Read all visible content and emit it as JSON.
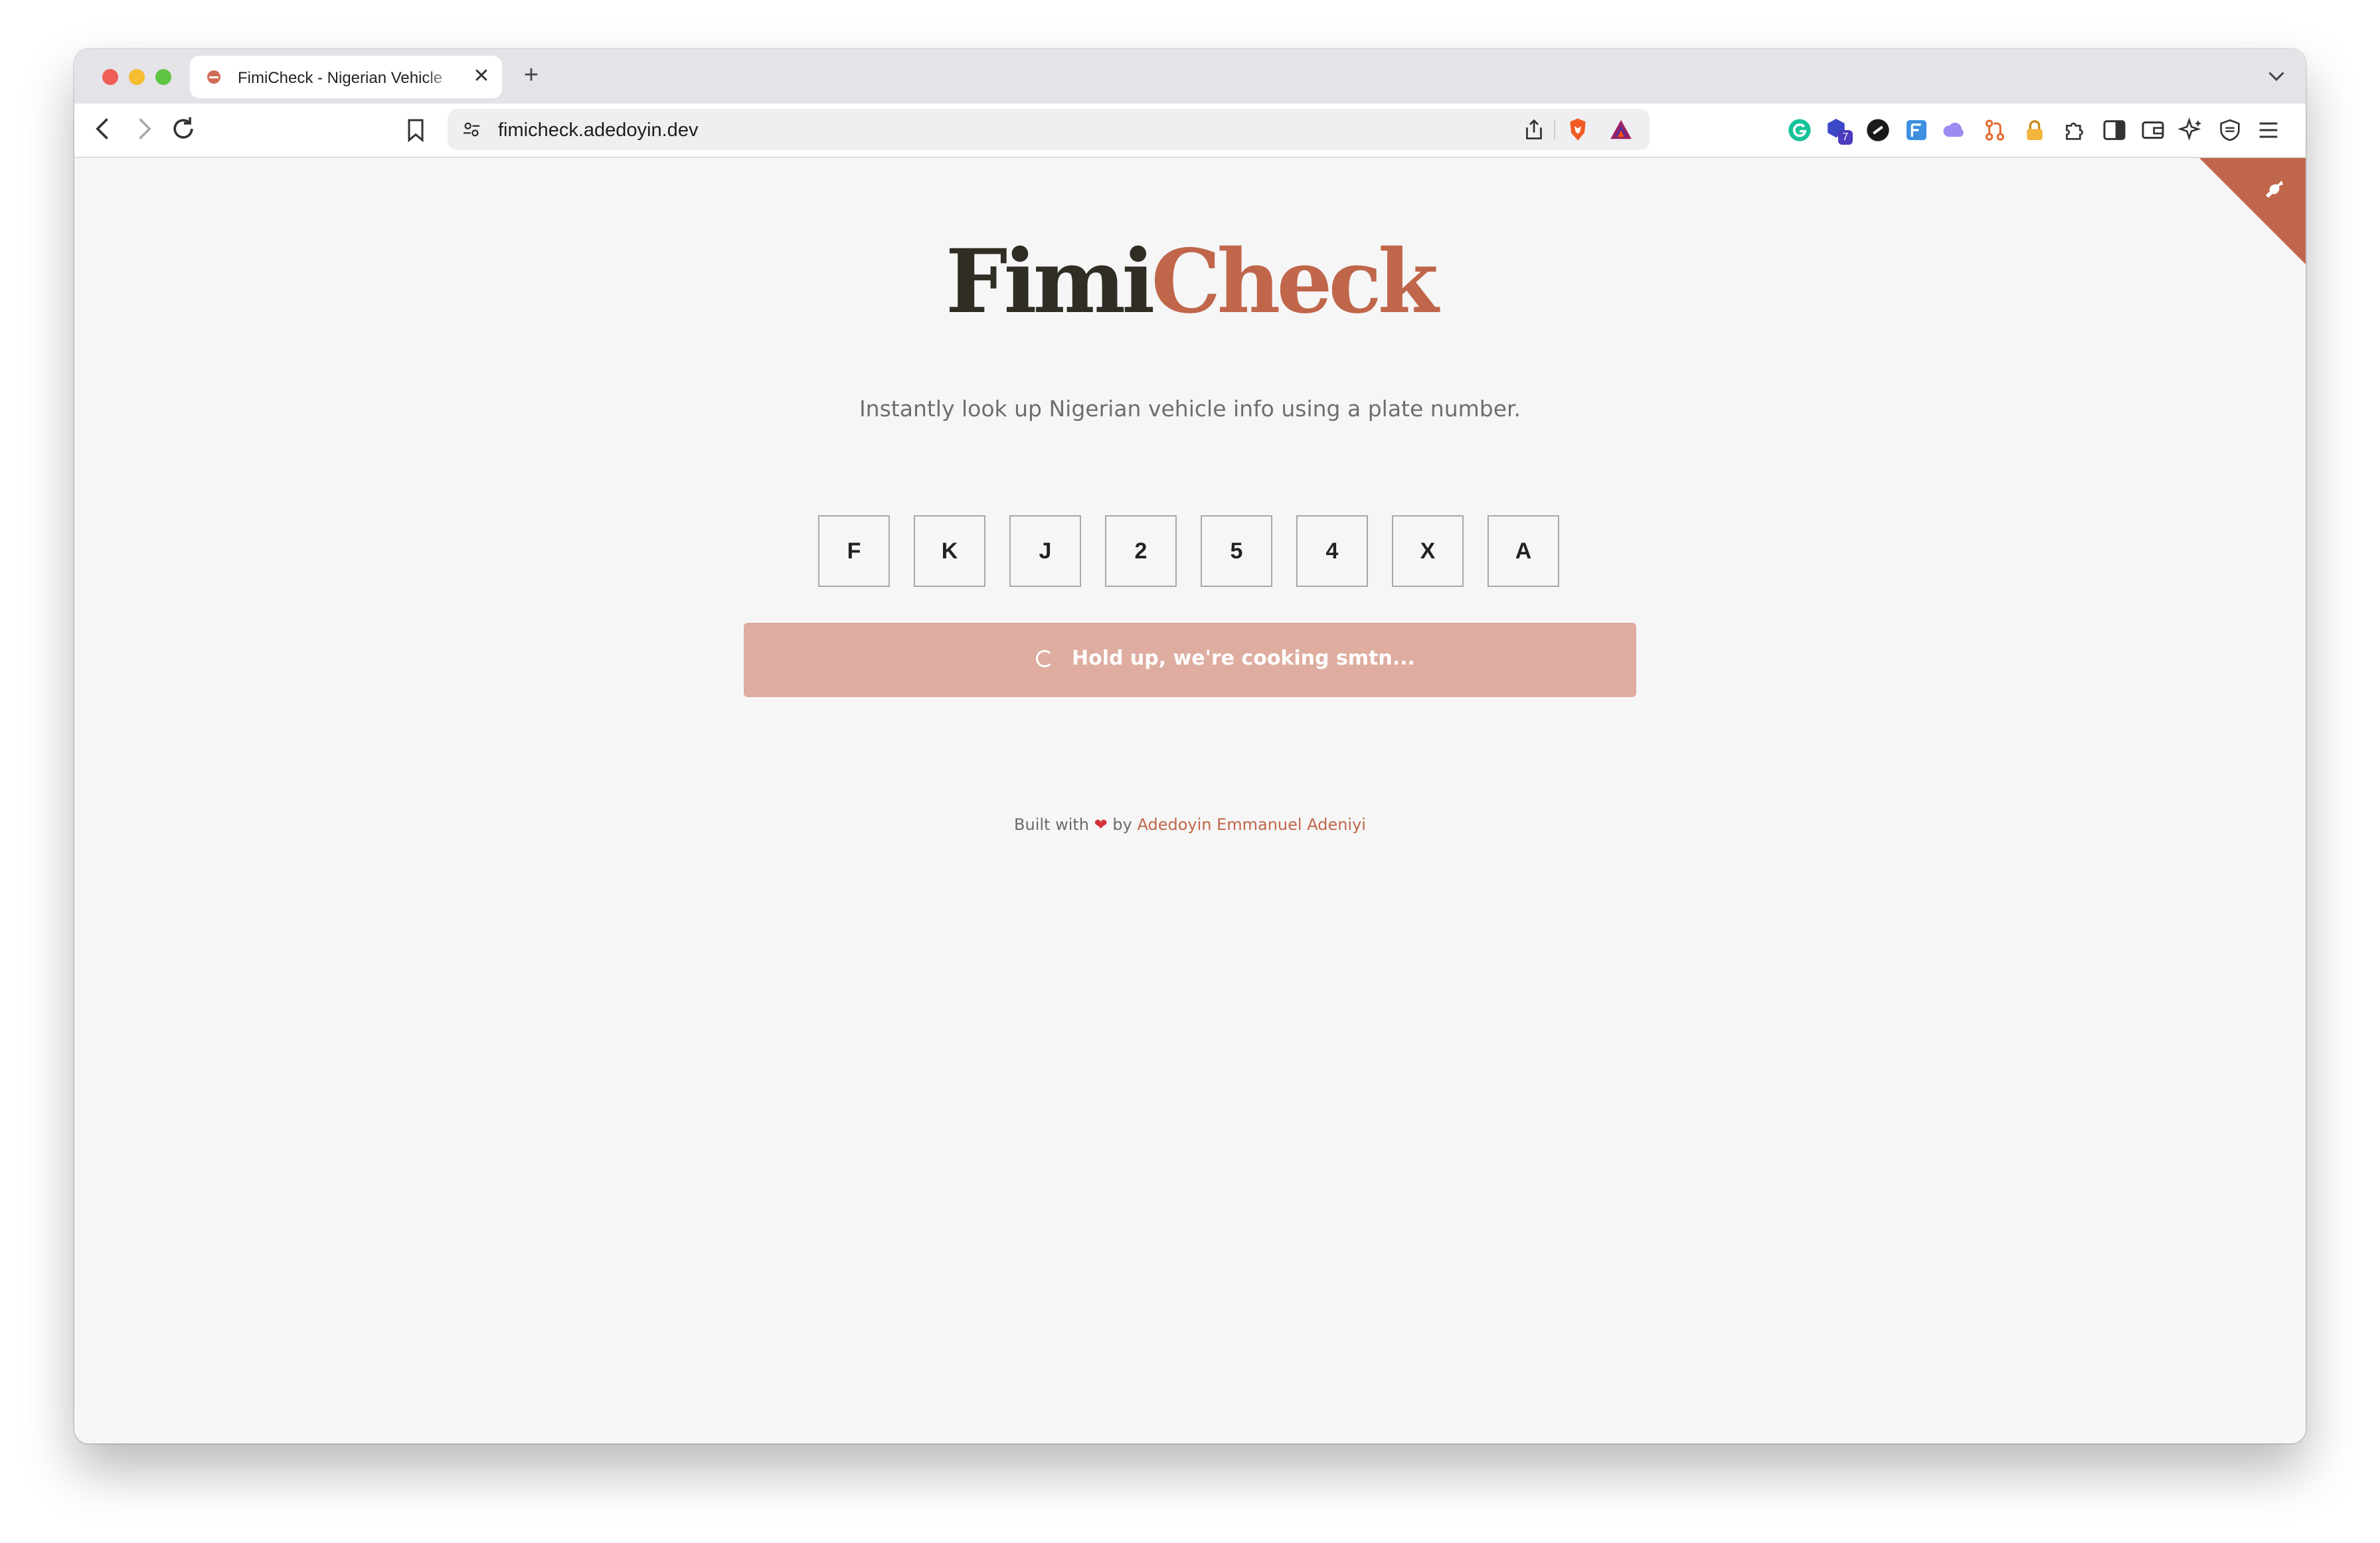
{
  "browser": {
    "tab_title": "FimiCheck - Nigerian Vehicle",
    "tab_close": "✕",
    "new_tab": "+",
    "url": "fimicheck.adedoyin.dev",
    "extension_badge_count": "7"
  },
  "page": {
    "logo_part1": "Fimi",
    "logo_part2": "Check",
    "tagline": "Instantly look up Nigerian vehicle info using a plate number.",
    "plate_chars": [
      "F",
      "K",
      "J",
      "2",
      "5",
      "4",
      "X",
      "A"
    ],
    "submit_label": "Hold up, we're cooking smtn...",
    "footer_prefix": "Built with",
    "footer_heart": "❤",
    "footer_by": "by",
    "footer_author": "Adedoyin Emmanuel Adeniyi"
  },
  "colors": {
    "brand_dark": "#2f2d24",
    "brand_accent": "#c0664b",
    "button_loading": "#deada0",
    "page_bg": "#f6f6f6"
  }
}
